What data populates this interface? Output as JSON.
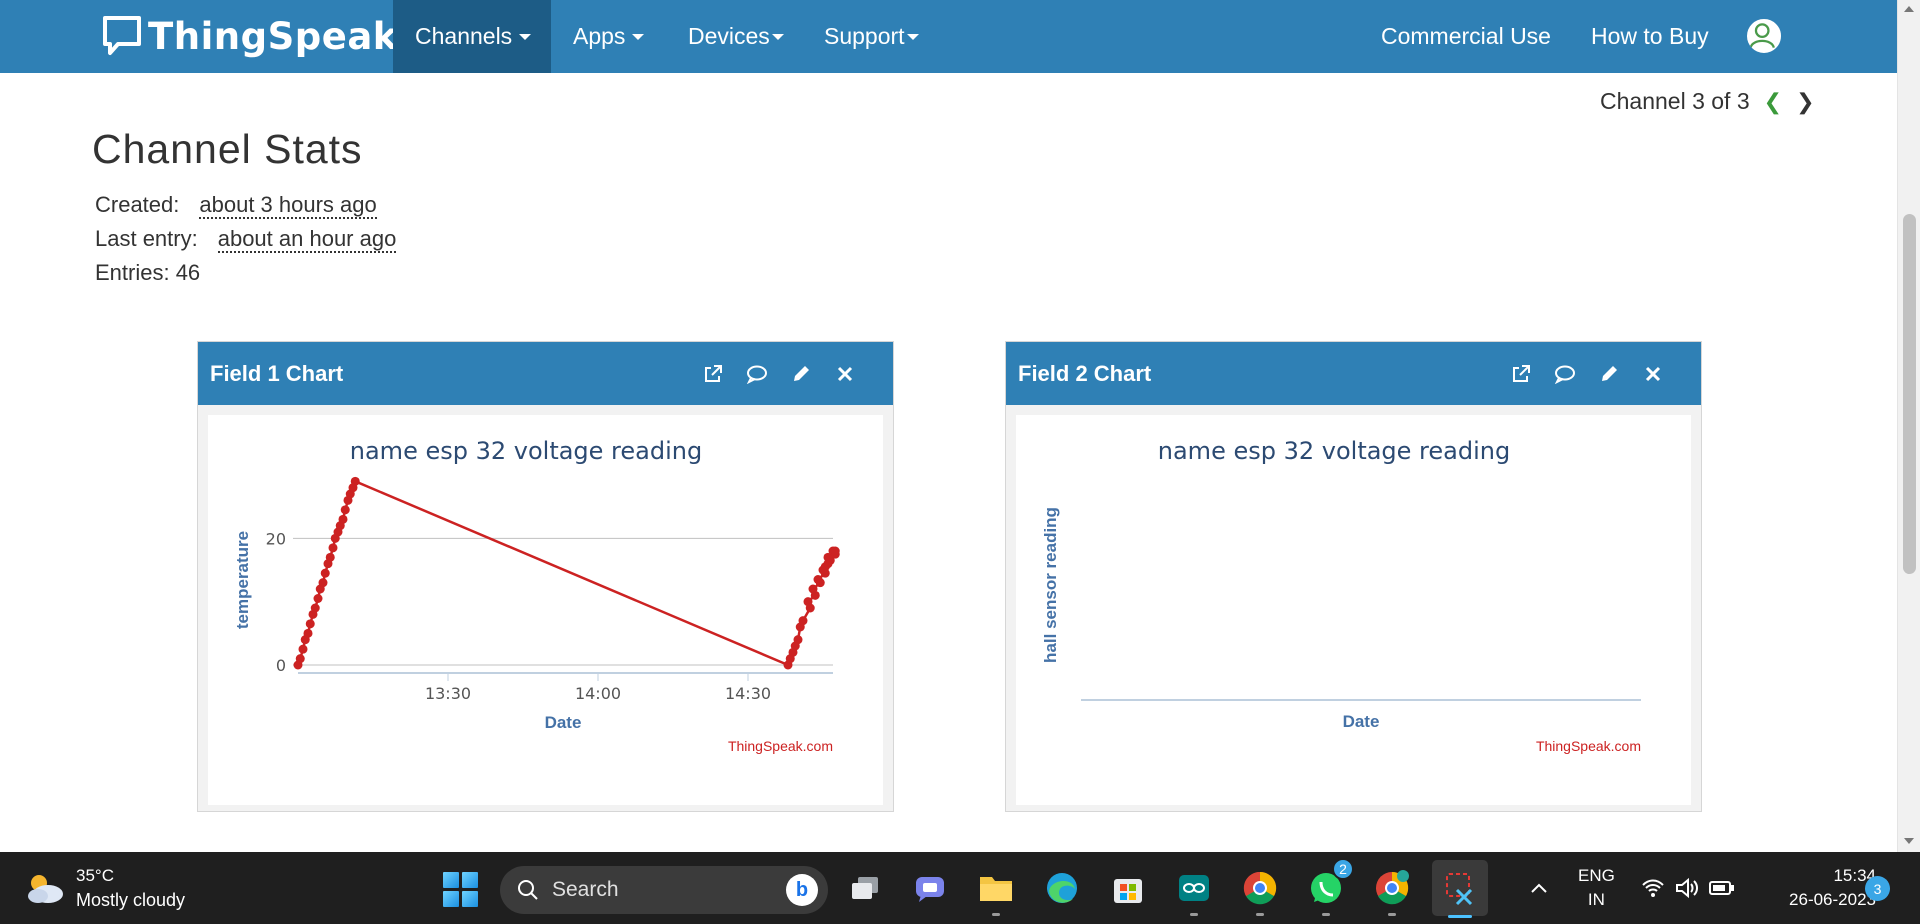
{
  "navbar": {
    "brand": "ThingSpeak",
    "brand_tm": "™",
    "items": [
      {
        "label": "Channels",
        "active": true
      },
      {
        "label": "Apps"
      },
      {
        "label": "Devices"
      },
      {
        "label": "Support"
      }
    ],
    "right_items": [
      "Commercial Use",
      "How to Buy"
    ]
  },
  "channel_nav": {
    "label": "Channel 3 of 3"
  },
  "stats": {
    "title": "Channel Stats",
    "created_label": "Created:",
    "created_value": "about 3 hours ago",
    "last_entry_label": "Last entry:",
    "last_entry_value": "about an hour ago",
    "entries": "Entries: 46"
  },
  "panels": [
    {
      "title": "Field 1 Chart",
      "icons": [
        "external-link-icon",
        "comment-icon",
        "pencil-icon",
        "close-icon"
      ]
    },
    {
      "title": "Field 2 Chart",
      "icons": [
        "external-link-icon",
        "comment-icon",
        "pencil-icon",
        "close-icon"
      ]
    }
  ],
  "chart_data": [
    {
      "type": "line",
      "title": "name esp 32 voltage reading",
      "xlabel": "Date",
      "ylabel": "temperature",
      "credit": "ThingSpeak.com",
      "x_ticks": [
        "13:30",
        "14:00",
        "14:30"
      ],
      "y_ticks": [
        0,
        20
      ],
      "xlim": [
        "13:00",
        "14:47"
      ],
      "ylim": [
        0,
        30
      ],
      "color": "#cc2222",
      "series": [
        {
          "x": [
            "13:00",
            "13:00",
            "13:01",
            "13:01",
            "13:02",
            "13:02",
            "13:03",
            "13:03",
            "13:04",
            "13:04",
            "13:05",
            "13:05",
            "13:06",
            "13:06",
            "13:07",
            "13:07",
            "13:08",
            "13:08",
            "13:09",
            "13:09",
            "13:10",
            "13:10",
            "13:11",
            "13:11",
            "14:38",
            "14:38",
            "14:39",
            "14:39",
            "14:40",
            "14:40",
            "14:41",
            "14:42",
            "14:42",
            "14:43",
            "14:43",
            "14:44",
            "14:44",
            "14:45",
            "14:45",
            "14:45",
            "14:46",
            "14:46",
            "14:46",
            "14:47",
            "14:47",
            "14:47"
          ],
          "y": [
            0,
            1,
            2.5,
            4,
            5,
            6.5,
            8,
            9,
            10.5,
            12,
            13,
            14.5,
            16,
            17,
            18.5,
            20,
            21,
            22,
            23,
            24.5,
            26,
            27,
            28,
            29,
            0,
            1,
            2,
            3,
            4,
            6,
            7,
            9,
            10,
            11,
            12,
            13,
            13.5,
            14.5,
            15,
            15.5,
            16,
            16.5,
            17,
            17.5,
            18,
            18
          ]
        }
      ]
    },
    {
      "type": "line",
      "title": "name esp 32 voltage reading",
      "xlabel": "Date",
      "ylabel": "hall sensor reading",
      "credit": "ThingSpeak.com",
      "series": []
    }
  ],
  "taskbar": {
    "weather_temp": "35°C",
    "weather_desc": "Mostly cloudy",
    "search_placeholder": "Search",
    "lang": "ENG",
    "region": "IN",
    "time": "15:34",
    "date": "26-06-2023",
    "notifications": "3",
    "whatsapp_badge": "2"
  }
}
